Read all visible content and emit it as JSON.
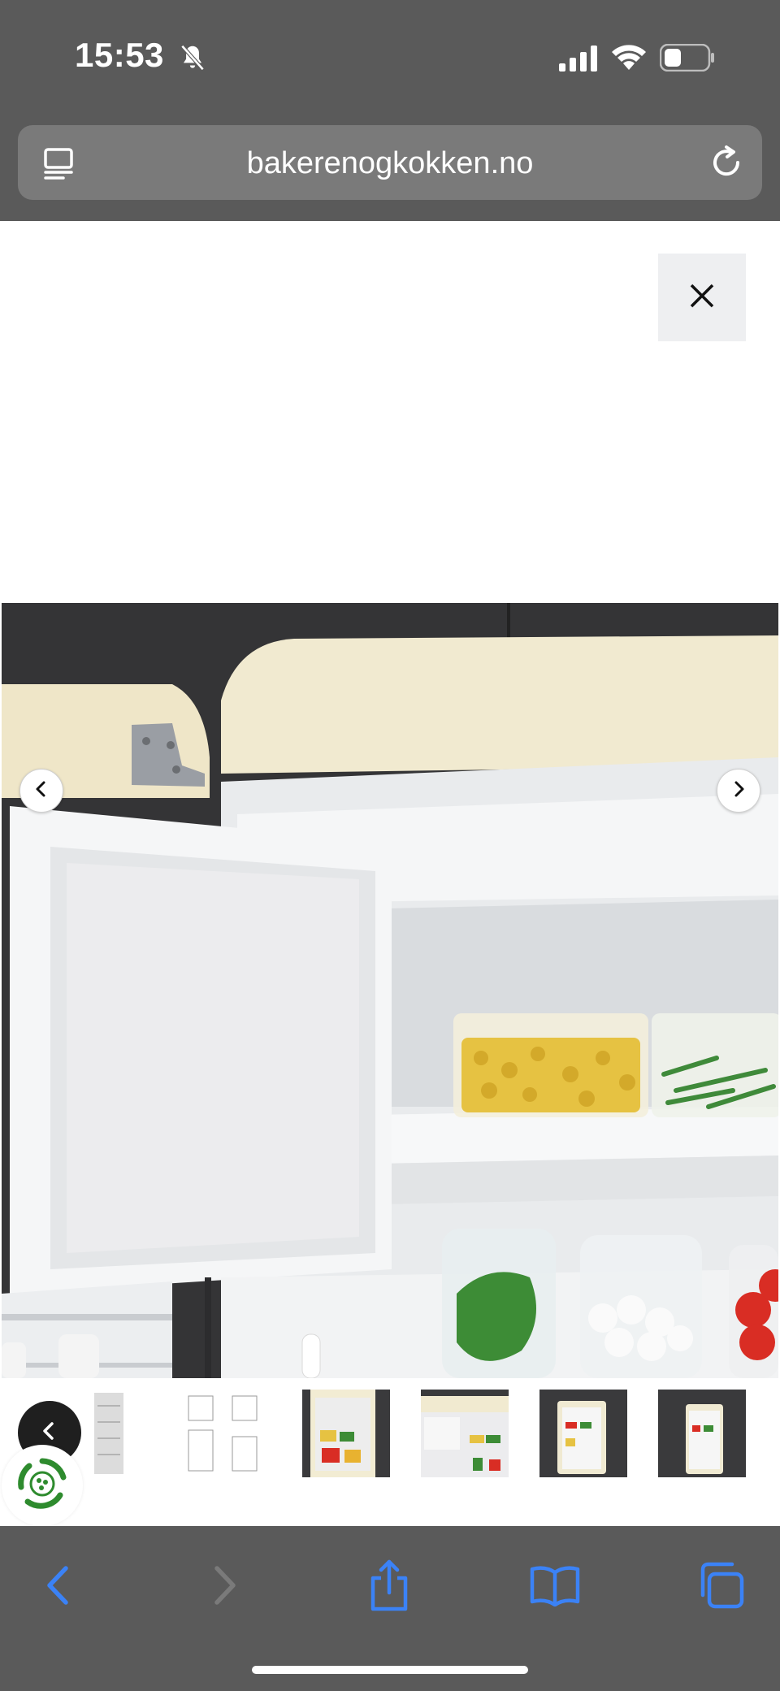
{
  "status_bar": {
    "time": "15:53",
    "icons": [
      "bell-slash-icon",
      "cellular-signal-icon",
      "wifi-icon",
      "battery-icon"
    ]
  },
  "browser": {
    "url": "bakerenogkokken.no",
    "icons": [
      "reader-mode-icon",
      "reload-icon"
    ]
  },
  "gallery": {
    "close_icon": "close-icon",
    "prev_icon": "chevron-left-icon",
    "next_icon": "chevron-right-icon",
    "thumbnail_count": 6,
    "thumbnails": [
      "product-thumbnail-1",
      "product-thumbnail-2",
      "product-thumbnail-3",
      "product-thumbnail-4",
      "product-thumbnail-5",
      "product-thumbnail-6"
    ]
  },
  "toolbar": {
    "icons": [
      "back-arrow-icon",
      "forward-arrow-icon",
      "share-icon",
      "bookmarks-icon",
      "tabs-icon"
    ]
  },
  "colors": {
    "chrome_bg": "#5a5a5a",
    "url_bar_bg": "#7a7a7a",
    "accent_blue": "#3b82f6",
    "cream": "#f3ecd0"
  }
}
